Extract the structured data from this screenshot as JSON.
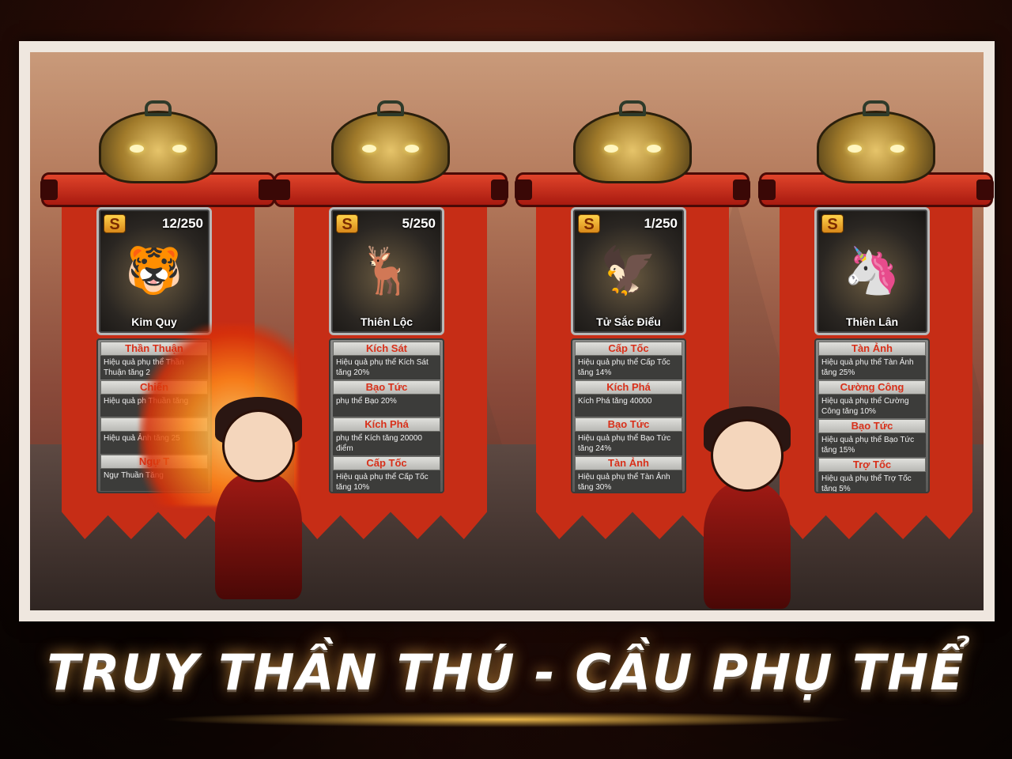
{
  "slogan": "TRUY THẦN THÚ - CẦU PHỤ THỂ",
  "pets": [
    {
      "grade": "S",
      "count": "12/250",
      "name": "Kim Quy",
      "icon": "golden-beast-icon",
      "glyph": "🐯",
      "stats": [
        {
          "title": "Thần Thuận",
          "desc": "Hiệu quả phụ thể Thần Thuận tăng 2"
        },
        {
          "title": "Chiến",
          "desc": "Hiệu quả ph Thuần tăng"
        },
        {
          "title": "",
          "desc": "Hiệu quả Ảnh tăng 25"
        },
        {
          "title": "Ngự T",
          "desc": "Ngự Thuần Tăng"
        }
      ]
    },
    {
      "grade": "S",
      "count": "5/250",
      "name": "Thiên Lộc",
      "icon": "red-deer-icon",
      "glyph": "🦌",
      "stats": [
        {
          "title": "Kích Sát",
          "desc": "Hiệu quả phụ thể Kích Sát tăng 20%"
        },
        {
          "title": "Bạo Tức",
          "desc": "phụ thể Bạo 20%"
        },
        {
          "title": "Kích Phá",
          "desc": "phụ thể Kích tăng 20000 điểm"
        },
        {
          "title": "Cấp Tốc",
          "desc": "Hiệu quả phụ thể Cấp Tốc tăng 10%"
        }
      ]
    },
    {
      "grade": "S",
      "count": "1/250",
      "name": "Tử Sắc Điểu",
      "icon": "purple-bird-icon",
      "glyph": "🦅",
      "stats": [
        {
          "title": "Cấp Tốc",
          "desc": "Hiệu quả phụ thể Cấp Tốc tăng 14%"
        },
        {
          "title": "Kích Phá",
          "desc": "Kích Phá tăng 40000"
        },
        {
          "title": "Bạo Tức",
          "desc": "Hiệu quả phụ thể Bạo Tức tăng 24%"
        },
        {
          "title": "Tàn Ảnh",
          "desc": "Hiệu quả phụ thể Tàn Ảnh tăng 30%"
        }
      ]
    },
    {
      "grade": "S",
      "count": "",
      "name": "Thiên Lân",
      "icon": "unicorn-icon",
      "glyph": "🦄",
      "stats": [
        {
          "title": "Tàn Ảnh",
          "desc": "Hiệu quả phụ thể Tàn Ảnh tăng 25%"
        },
        {
          "title": "Cường Công",
          "desc": "Hiệu quả phụ thể Cường Công tăng 10%"
        },
        {
          "title": "Bạo Tức",
          "desc": "Hiệu quả phụ thể Bạo Tức tăng 15%"
        },
        {
          "title": "Trợ Tốc",
          "desc": "Hiệu quả phụ thể Trợ Tốc tăng 5%"
        }
      ]
    }
  ]
}
